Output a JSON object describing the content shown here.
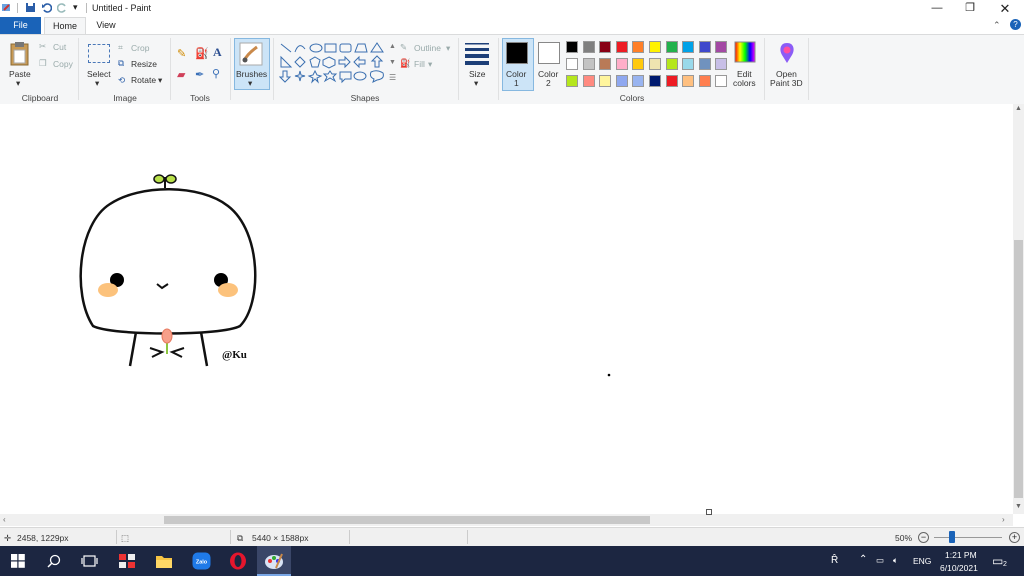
{
  "window": {
    "title": "Untitled - Paint"
  },
  "tabs": {
    "file": "File",
    "home": "Home",
    "view": "View"
  },
  "ribbon": {
    "clipboard": {
      "paste": "Paste",
      "cut": "Cut",
      "copy": "Copy",
      "label": "Clipboard"
    },
    "image": {
      "select": "Select",
      "crop": "Crop",
      "resize": "Resize",
      "rotate": "Rotate",
      "label": "Image"
    },
    "tools": {
      "label": "Tools"
    },
    "brushes": {
      "label": "Brushes"
    },
    "shapes": {
      "outline": "Outline",
      "fill": "Fill",
      "label": "Shapes"
    },
    "size": {
      "label": "Size"
    },
    "colors": {
      "color1": "Color\n1",
      "color1_a": "Color",
      "color1_b": "1",
      "color2_a": "Color",
      "color2_b": "2",
      "edit_a": "Edit",
      "edit_b": "colors",
      "label": "Colors",
      "row1": [
        "#000000",
        "#7f7f7f",
        "#880015",
        "#ed1c24",
        "#ff7f27",
        "#fff200",
        "#22b14c",
        "#00a2e8",
        "#3f48cc",
        "#a349a4"
      ],
      "row2": [
        "#ffffff",
        "#c3c3c3",
        "#b97a57",
        "#ffaec9",
        "#ffc90e",
        "#efe4b0",
        "#b5e61d",
        "#99d9ea",
        "#7092be",
        "#c8bfe7"
      ],
      "row3": [
        "#b5e61d",
        "#ff8a80",
        "#fff59d",
        "#8fa8f0",
        "#99b4f0",
        "#001a70",
        "#ed1c24",
        "#ffc080",
        "#ff7f50",
        "#ffffff"
      ]
    },
    "paint3d": {
      "a": "Open",
      "b": "Paint 3D"
    }
  },
  "drawing": {
    "signature": "@Ku"
  },
  "status": {
    "cursor": "2458, 1229px",
    "size": "5440 × 1588px",
    "zoom": "50%"
  },
  "taskbar": {
    "lang": "ENG",
    "time": "1:21 PM",
    "date": "6/10/2021",
    "notif_count": "2"
  }
}
